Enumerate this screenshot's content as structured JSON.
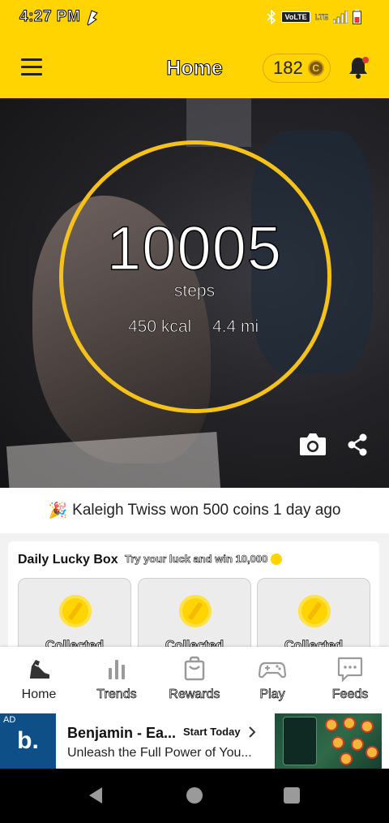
{
  "status_bar": {
    "time": "4:27 PM",
    "volte": "VoLTE",
    "network": "LTE"
  },
  "app_bar": {
    "title": "Home",
    "coin_balance": "182",
    "coin_symbol": "C"
  },
  "hero": {
    "steps": "10005",
    "steps_label": "steps",
    "calories": "450 kcal",
    "distance": "4.4 mi",
    "ring_color": "#f6c21a"
  },
  "winner_banner": {
    "emoji": "🎉",
    "text": "Kaleigh Twiss won 500 coins 1 day ago"
  },
  "lucky_box": {
    "title": "Daily Lucky Box",
    "subtitle": "Try your luck and win 10,000",
    "boxes": [
      {
        "label": "Collected"
      },
      {
        "label": "Collected"
      },
      {
        "label": "Collected"
      }
    ]
  },
  "bottom_nav": {
    "items": [
      {
        "label": "Home",
        "icon": "sneaker-icon",
        "active": true
      },
      {
        "label": "Trends",
        "icon": "bar-chart-icon",
        "active": false
      },
      {
        "label": "Rewards",
        "icon": "shopping-bag-icon",
        "active": false
      },
      {
        "label": "Play",
        "icon": "gamepad-icon",
        "active": false
      },
      {
        "label": "Feeds",
        "icon": "chat-bubble-icon",
        "active": false
      }
    ]
  },
  "ad": {
    "tag": "AD",
    "logo_letter": "b.",
    "title": "Benjamin - Ea...",
    "cta": "Start Today",
    "description": "Unleash the Full Power of You..."
  },
  "colors": {
    "brand_yellow": "#ffd400",
    "ad_blue": "#0d4f86"
  }
}
